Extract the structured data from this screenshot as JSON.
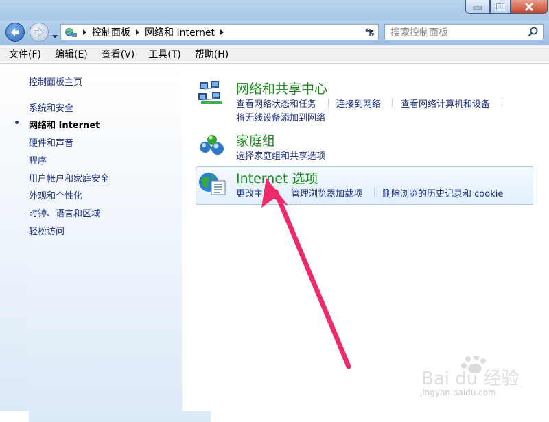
{
  "window": {
    "buttons": {
      "minimize": "minimize-icon",
      "maximize": "maximize-icon",
      "close": "close-icon"
    }
  },
  "address_bar": {
    "breadcrumbs": [
      "控制面板",
      "网络和 Internet"
    ],
    "search_placeholder": "搜索控制面板"
  },
  "menu": {
    "items": [
      "文件(F)",
      "编辑(E)",
      "查看(V)",
      "工具(T)",
      "帮助(H)"
    ]
  },
  "sidebar": {
    "items": [
      {
        "label": "控制面板主页",
        "active": false
      },
      {
        "label": "系统和安全",
        "active": false
      },
      {
        "label": "网络和 Internet",
        "active": true
      },
      {
        "label": "硬件和声音",
        "active": false
      },
      {
        "label": "程序",
        "active": false
      },
      {
        "label": "用户帐户和家庭安全",
        "active": false
      },
      {
        "label": "外观和个性化",
        "active": false
      },
      {
        "label": "时钟、语言和区域",
        "active": false
      },
      {
        "label": "轻松访问",
        "active": false
      }
    ]
  },
  "categories": [
    {
      "title": "网络和共享中心",
      "icon": "network-center-icon",
      "links": [
        "查看网络状态和任务",
        "连接到网络",
        "查看网络计算机和设备",
        "将无线设备添加到网络"
      ]
    },
    {
      "title": "家庭组",
      "icon": "homegroup-icon",
      "links": [
        "选择家庭组和共享选项"
      ]
    },
    {
      "title": "Internet 选项",
      "icon": "internet-options-icon",
      "highlighted": true,
      "links": [
        "更改主页",
        "管理浏览器加载项",
        "删除浏览的历史记录和 cookie"
      ]
    }
  ],
  "annotation": {
    "type": "arrow",
    "color": "#ee2a6a"
  },
  "watermark": {
    "logo_text": "Bai du 经验",
    "sub_text": "jingyan.baidu.com"
  },
  "colors": {
    "title_green": "#1e8a1e",
    "link_blue": "#1e3287",
    "arrow": "#ee2a6a"
  }
}
